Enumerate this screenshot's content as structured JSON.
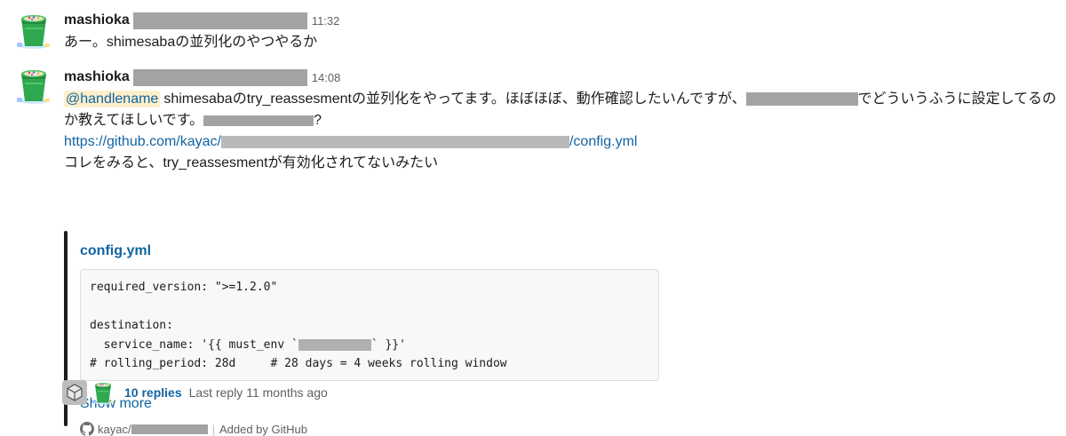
{
  "messages": [
    {
      "author": "mashioka",
      "time": "11:32",
      "text": "あー。shimesabaの並列化のやつやるか"
    },
    {
      "author": "mashioka",
      "time": "14:08",
      "mention": "@handlename",
      "text_1": "shimesabaのtry_reassesmentの並列化をやってます。ほぼほぼ、動作確認したいんですが、",
      "text_2": "でどういうふうに設定してるのか教えてほしいです。",
      "text_3": "?",
      "link_prefix": "https://github.com/kayac/",
      "link_suffix": "/config.yml",
      "text_4": "コレをみると、try_reassesmentが有効化されてないみたい"
    }
  ],
  "attachment": {
    "title": "config.yml",
    "code": {
      "line1": "required_version: \">=1.2.0\"",
      "line2": "",
      "line3": "destination:",
      "line4_prefix": "  service_name: '{{ must_env `",
      "line4_suffix": "` }}'",
      "line5": "# rolling_period: 28d     # 28 days = 4 weeks rolling window"
    },
    "show_more": "Show more",
    "footer_repo_prefix": "kayac/",
    "footer_added": "Added by GitHub"
  },
  "thread": {
    "replies": "10 replies",
    "last_reply": "Last reply 11 months ago"
  },
  "icons": {
    "avatar": "bucket-avatar-icon",
    "github": "github-icon",
    "cube": "cube-avatar-icon"
  },
  "colors": {
    "link": "#1264a3",
    "mention_bg": "#fcefcb",
    "text": "#1d1c1d",
    "muted": "#616061"
  }
}
